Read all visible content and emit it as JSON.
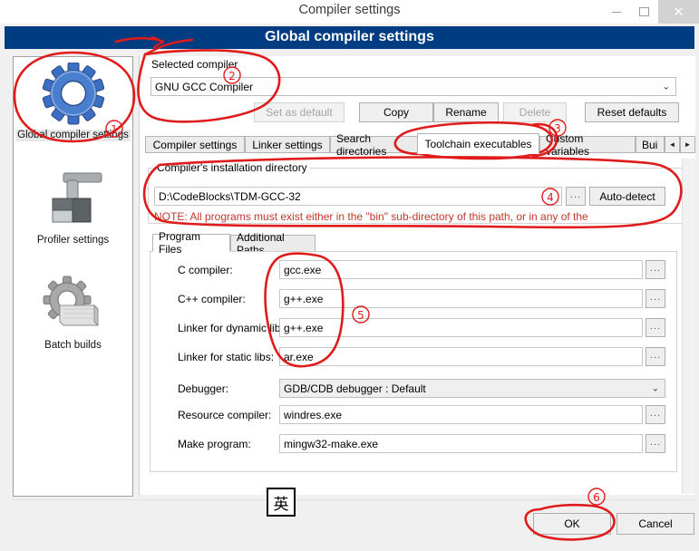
{
  "window": {
    "title": "Compiler settings",
    "minimize_label": "–",
    "maximize_label": "□",
    "close_label": "✕"
  },
  "banner": {
    "title": "Global compiler settings"
  },
  "sidebar": {
    "items": [
      {
        "label": "Global compiler settings",
        "icon": "blue-gear-icon",
        "selected": true
      },
      {
        "label": "Profiler settings",
        "icon": "clamp-icon",
        "selected": false
      },
      {
        "label": "Batch builds",
        "icon": "gray-gear-stack-icon",
        "selected": false
      }
    ]
  },
  "compiler_select": {
    "group_label": "Selected compiler",
    "value": "GNU GCC Compiler",
    "caret": "⌄",
    "buttons": [
      {
        "label": "Set as default",
        "enabled": false
      },
      {
        "label": "Copy",
        "enabled": true
      },
      {
        "label": "Rename",
        "enabled": true
      },
      {
        "label": "Delete",
        "enabled": false
      },
      {
        "label": "Reset defaults",
        "enabled": true
      }
    ]
  },
  "main_tabs": {
    "items": [
      {
        "label": "Compiler settings",
        "active": false
      },
      {
        "label": "Linker settings",
        "active": false
      },
      {
        "label": "Search directories",
        "active": false
      },
      {
        "label": "Toolchain executables",
        "active": true
      },
      {
        "label": "Custom variables",
        "active": false
      },
      {
        "label": "Bui",
        "active": false
      }
    ],
    "scroll_left": "◄",
    "scroll_right": "►"
  },
  "install_dir": {
    "group_label": "Compiler's installation directory",
    "path": "D:\\CodeBlocks\\TDM-GCC-32",
    "browse_label": "...",
    "auto_detect_label": "Auto-detect",
    "note": "NOTE: All programs must exist either in the \"bin\" sub-directory of this path, or in any of the"
  },
  "sub_tabs": {
    "items": [
      {
        "label": "Program Files",
        "active": true
      },
      {
        "label": "Additional Paths",
        "active": false
      }
    ]
  },
  "program_files": {
    "browse_label": "...",
    "debugger_caret": "⌄",
    "rows": [
      {
        "label": "C compiler:",
        "value": "gcc.exe",
        "type": "text"
      },
      {
        "label": "C++ compiler:",
        "value": "g++.exe",
        "type": "text"
      },
      {
        "label": "Linker for dynamic libs:",
        "value": "g++.exe",
        "type": "text"
      },
      {
        "label": "Linker for static libs:",
        "value": "ar.exe",
        "type": "text"
      },
      {
        "label": "Debugger:",
        "value": "GDB/CDB debugger : Default",
        "type": "combo"
      },
      {
        "label": "Resource compiler:",
        "value": "windres.exe",
        "type": "text"
      },
      {
        "label": "Make program:",
        "value": "mingw32-make.exe",
        "type": "text"
      }
    ]
  },
  "ime_indicator": {
    "label": "英"
  },
  "footer": {
    "ok_label": "OK",
    "cancel_label": "Cancel"
  },
  "annotations": {
    "color": "#e01b1b",
    "markers": [
      {
        "id": "1",
        "target": "sidebar-global-compiler-settings"
      },
      {
        "id": "2",
        "target": "selected-compiler-group"
      },
      {
        "id": "3",
        "target": "toolchain-executables-tab"
      },
      {
        "id": "4",
        "target": "installation-directory-field"
      },
      {
        "id": "5",
        "target": "compiler-executable-fields"
      },
      {
        "id": "6",
        "target": "ok-button"
      }
    ]
  }
}
